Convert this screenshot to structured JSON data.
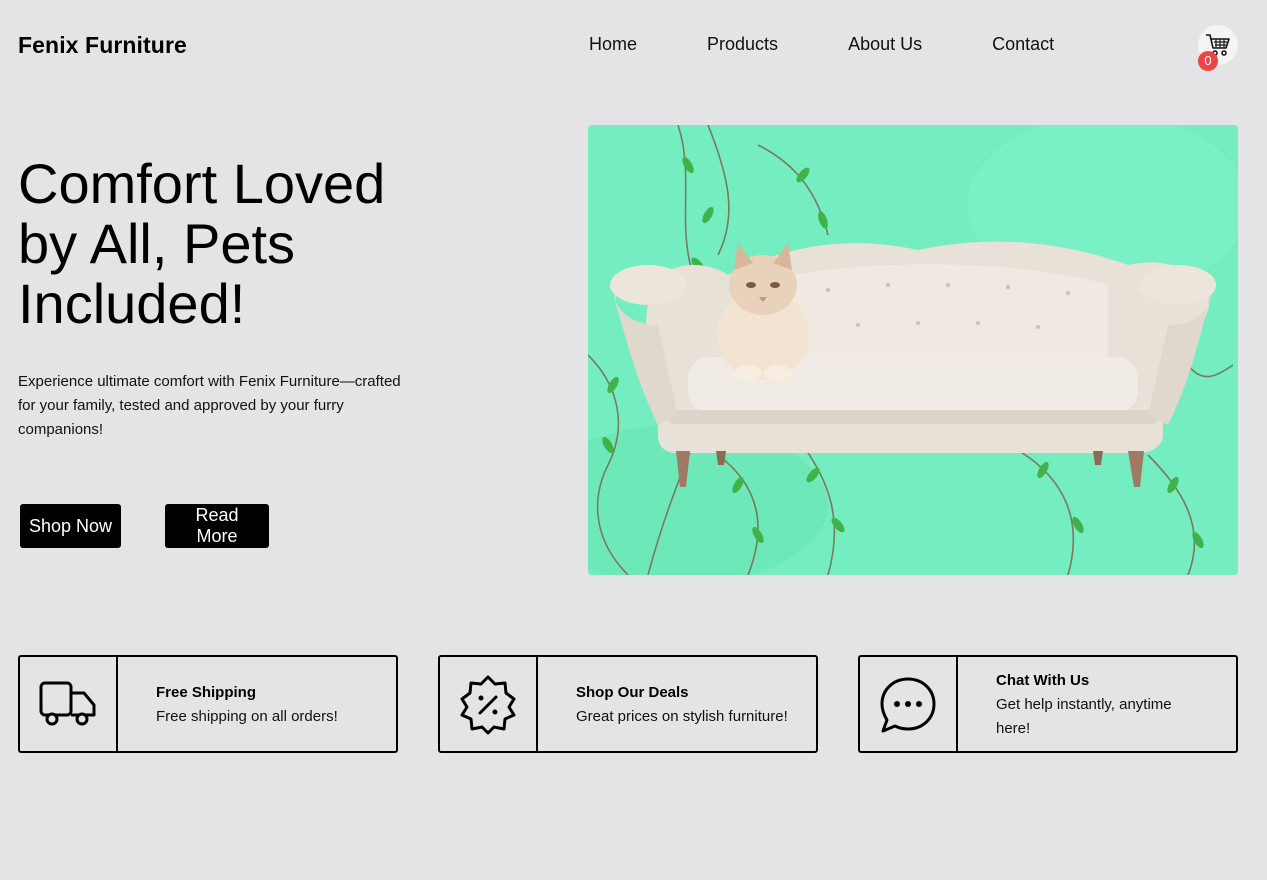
{
  "header": {
    "brand": "Fenix Furniture",
    "nav": [
      "Home",
      "Products",
      "About Us",
      "Contact"
    ],
    "cart_count": "0"
  },
  "hero": {
    "title": "Comfort Loved by All, Pets Included!",
    "description": "Experience ultimate comfort with Fenix Furniture—crafted for your family, tested and approved by your furry companions!",
    "primary_button": "Shop Now",
    "secondary_button": "Read More",
    "image_icon": "sofa-with-cat-image"
  },
  "features": [
    {
      "icon": "truck-icon",
      "title": "Free Shipping",
      "description": "Free shipping on all orders!"
    },
    {
      "icon": "discount-badge-icon",
      "title": "Shop Our Deals",
      "description": "Great prices on stylish furniture!"
    },
    {
      "icon": "chat-bubble-icon",
      "title": "Chat With Us",
      "description": "Get help instantly, anytime here!"
    }
  ],
  "colors": {
    "background": "#e4e4e7",
    "button": "#000000",
    "badge": "#ef4444",
    "hero_backdrop": "#6ff0bf"
  }
}
